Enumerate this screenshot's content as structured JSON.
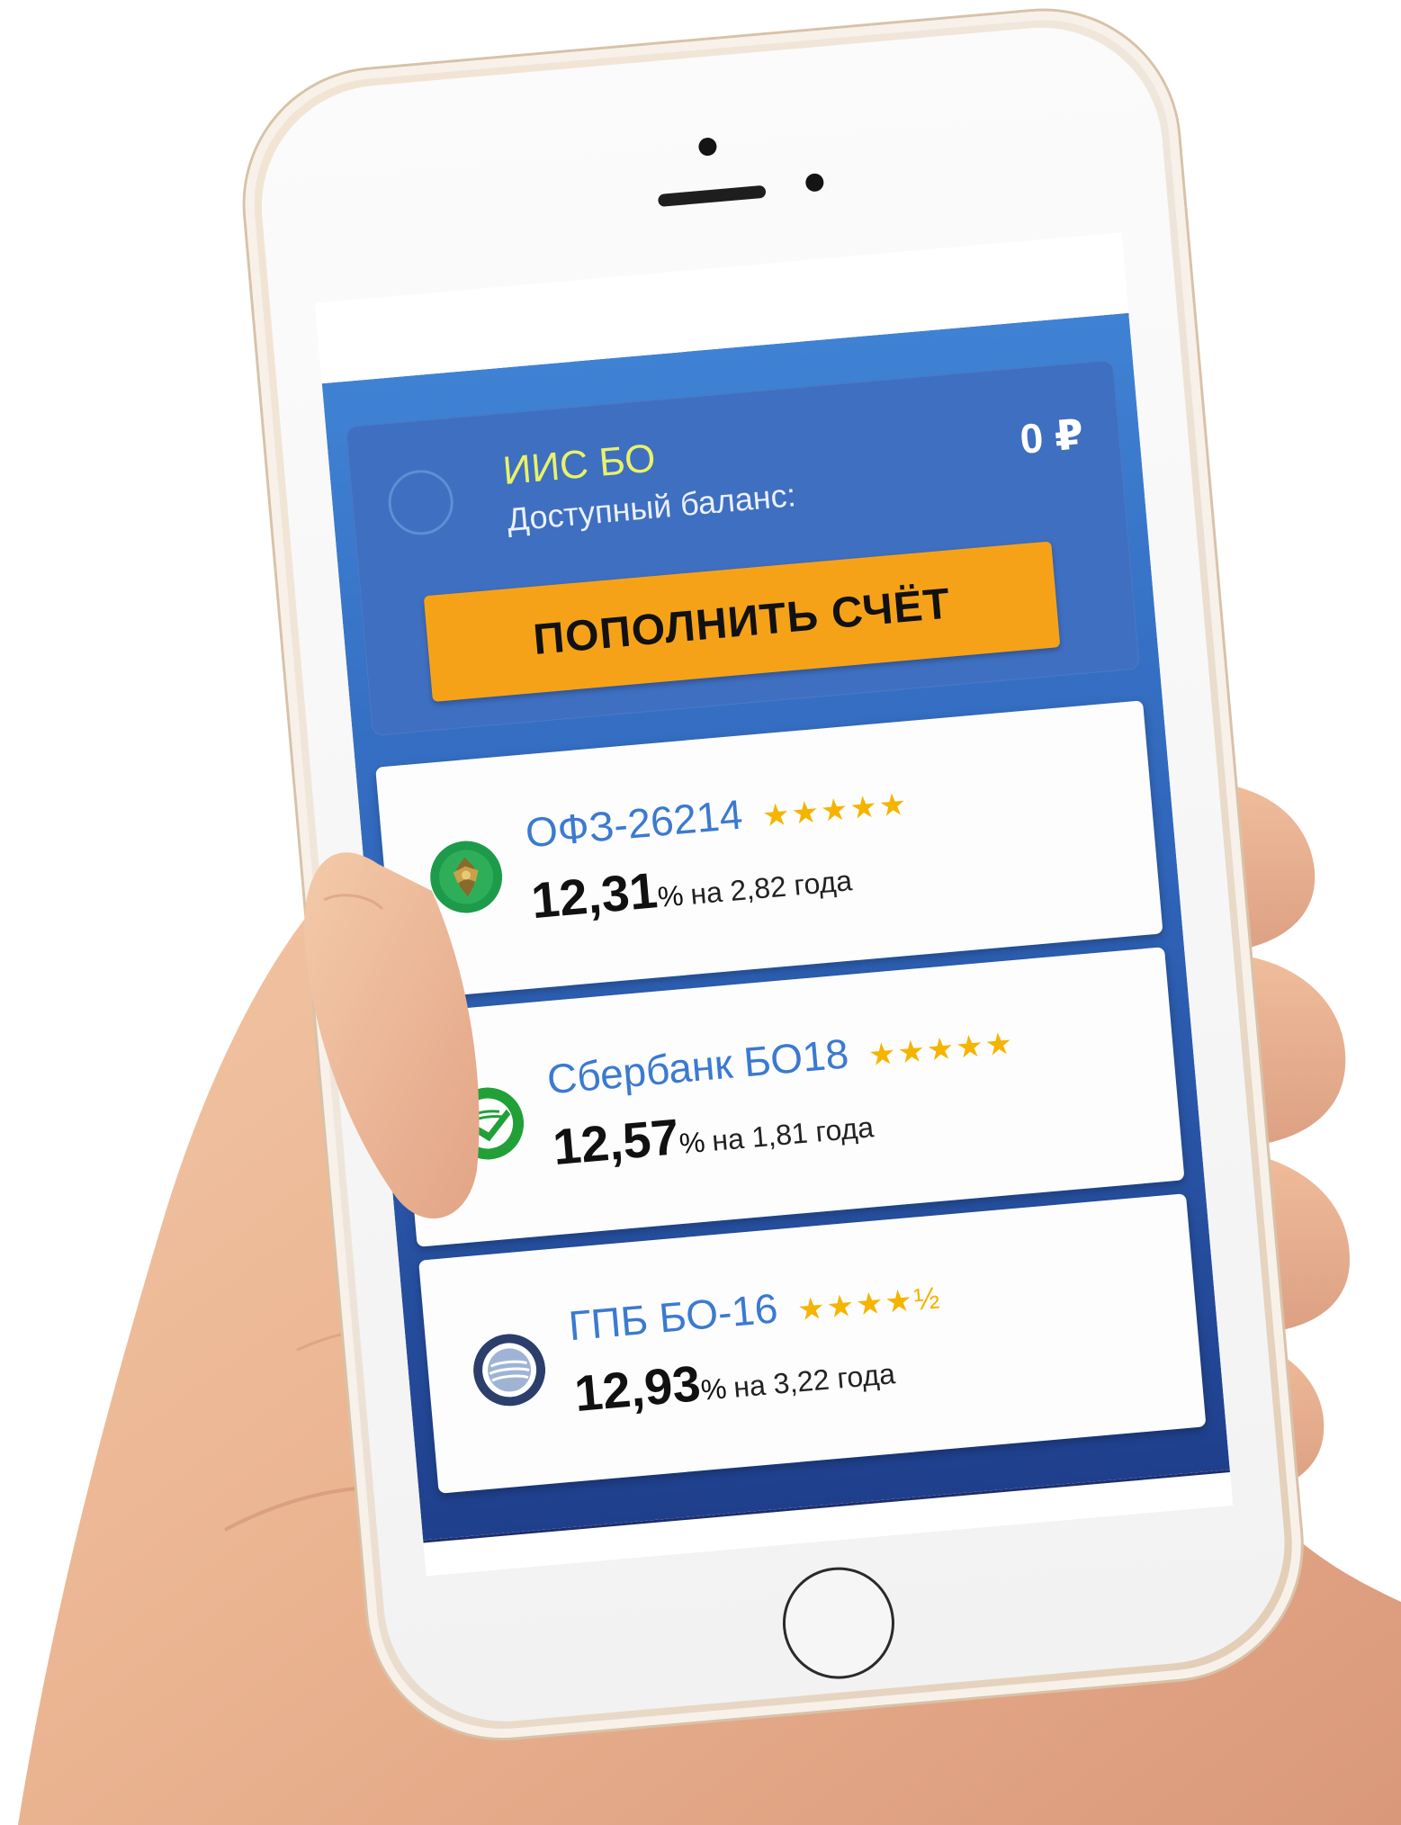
{
  "account": {
    "name": "ИИС БО",
    "balance_label": "Доступный баланс:",
    "balance": "0 ₽",
    "topup_button": "ПОПОЛНИТЬ СЧЁТ"
  },
  "bonds": [
    {
      "name": "ОФЗ-26214",
      "rating": 5,
      "stars": "★★★★★",
      "yield": "12,31",
      "percent": "%",
      "term": "на 2,82 года",
      "logo_icon": "minfin-emblem-icon",
      "logo_color": "#1e9b4a"
    },
    {
      "name": "Сбербанк БО18",
      "rating": 5,
      "stars": "★★★★★",
      "yield": "12,57",
      "percent": "%",
      "term": "на 1,81 года",
      "logo_icon": "sberbank-logo-icon",
      "logo_color": "#21a038"
    },
    {
      "name": "ГПБ БО-16",
      "rating": 4.5,
      "stars": "★★★★½",
      "yield": "12,93",
      "percent": "%",
      "term": "на 3,22 года",
      "logo_icon": "gazprombank-logo-icon",
      "logo_color": "#2c3e6b"
    }
  ],
  "colors": {
    "app_gradient_top": "#3f82d4",
    "app_gradient_bottom": "#1f3f8c",
    "button": "#f6a218",
    "account_name": "#e8f26a",
    "bond_name": "#3b7ad0",
    "stars": "#f5b400"
  }
}
